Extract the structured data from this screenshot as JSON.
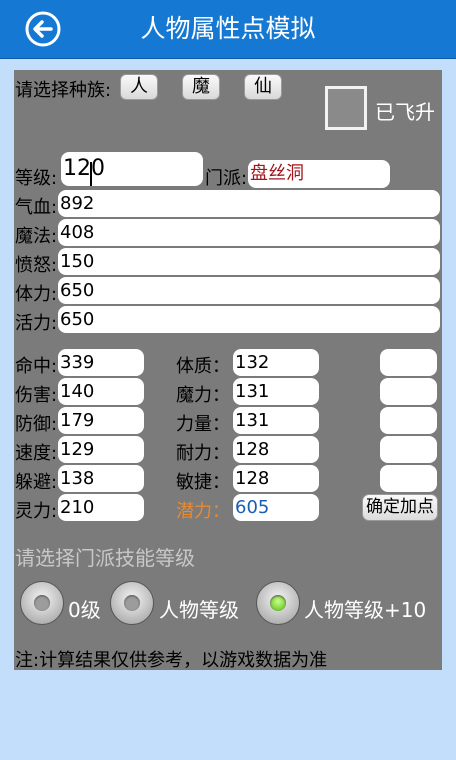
{
  "header": {
    "title": "人物属性点模拟"
  },
  "race": {
    "label": "请选择种族:",
    "options": [
      "人",
      "魔",
      "仙"
    ]
  },
  "ascended": {
    "label": "已飞升",
    "checked": false
  },
  "level": {
    "label": "等级:",
    "value": "120"
  },
  "sect": {
    "label": "门派:",
    "value": "盘丝洞"
  },
  "stats": [
    {
      "label": "气血:",
      "value": "892"
    },
    {
      "label": "魔法:",
      "value": "408"
    },
    {
      "label": "愤怒:",
      "value": "150"
    },
    {
      "label": "体力:",
      "value": "650"
    },
    {
      "label": "活力:",
      "value": "650"
    }
  ],
  "combat": [
    {
      "label": "命中:",
      "value": "339"
    },
    {
      "label": "伤害:",
      "value": "140"
    },
    {
      "label": "防御:",
      "value": "179"
    },
    {
      "label": "速度:",
      "value": "129"
    },
    {
      "label": "躲避:",
      "value": "138"
    },
    {
      "label": "灵力:",
      "value": "210"
    }
  ],
  "attributes": [
    {
      "label": "体质：",
      "value": "132",
      "add": ""
    },
    {
      "label": "魔力：",
      "value": "131",
      "add": ""
    },
    {
      "label": "力量：",
      "value": "131",
      "add": ""
    },
    {
      "label": "耐力：",
      "value": "128",
      "add": ""
    },
    {
      "label": "敏捷：",
      "value": "128",
      "add": ""
    }
  ],
  "potential": {
    "label": "潜力：",
    "value": "605"
  },
  "confirm_label": "确定加点",
  "skill": {
    "label": "请选择门派技能等级",
    "options": [
      "0级",
      "人物等级",
      "人物等级+10"
    ],
    "selected_index": 2
  },
  "note": "注:计算结果仅供参考，以游戏数据为准",
  "colors": {
    "header": "#1578d3",
    "panel": "#7b7b7b",
    "background": "#c3defa",
    "potential_label": "#e98a2f",
    "potential_value": "#1a5fb4",
    "sect_value": "#a0141c"
  }
}
